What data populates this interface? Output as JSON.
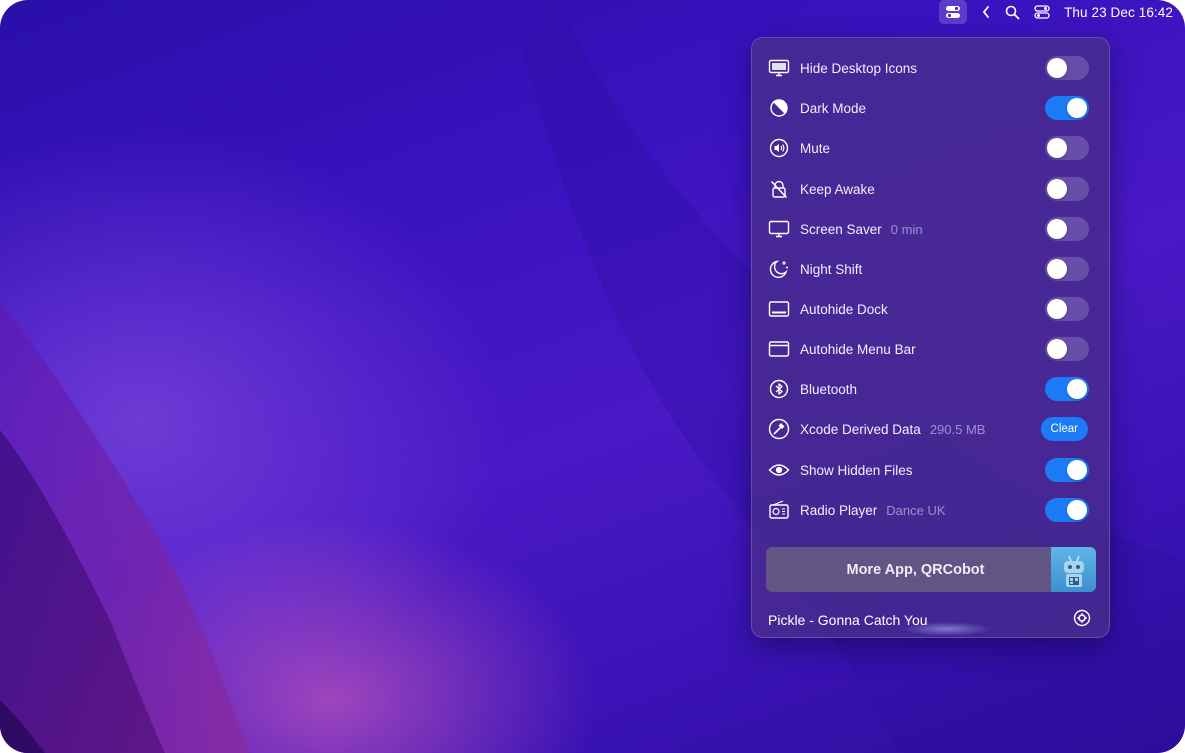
{
  "menubar": {
    "date_time": "Thu 23 Dec  16:42",
    "icons": [
      "app-toggle-icon",
      "chevron-left-icon",
      "search-icon",
      "control-center-icon"
    ]
  },
  "panel": {
    "items": [
      {
        "label": "Hide Desktop Icons",
        "sub": "",
        "icon": "monitor-icon",
        "control": "toggle",
        "on": false
      },
      {
        "label": "Dark Mode",
        "sub": "",
        "icon": "dark-mode-icon",
        "control": "toggle",
        "on": true
      },
      {
        "label": "Mute",
        "sub": "",
        "icon": "speaker-icon",
        "control": "toggle",
        "on": false
      },
      {
        "label": "Keep Awake",
        "sub": "",
        "icon": "lock-slash-icon",
        "control": "toggle",
        "on": false
      },
      {
        "label": "Screen Saver",
        "sub": "0 min",
        "icon": "display-icon",
        "control": "toggle",
        "on": false
      },
      {
        "label": "Night Shift",
        "sub": "",
        "icon": "moon-stars-icon",
        "control": "toggle",
        "on": false
      },
      {
        "label": "Autohide Dock",
        "sub": "",
        "icon": "dock-icon",
        "control": "toggle",
        "on": false
      },
      {
        "label": "Autohide Menu Bar",
        "sub": "",
        "icon": "menu-bar-icon",
        "control": "toggle",
        "on": false
      },
      {
        "label": "Bluetooth",
        "sub": "",
        "icon": "bluetooth-icon",
        "control": "toggle",
        "on": true
      },
      {
        "label": "Xcode Derived Data",
        "sub": "290.5 MB",
        "icon": "hammer-icon",
        "control": "button",
        "button_label": "Clear"
      },
      {
        "label": "Show Hidden Files",
        "sub": "",
        "icon": "eye-icon",
        "control": "toggle",
        "on": true
      },
      {
        "label": "Radio Player",
        "sub": "Dance UK",
        "icon": "radio-icon",
        "control": "toggle",
        "on": true
      }
    ],
    "banner": {
      "text": "More App, QRCobot",
      "image_icon": "robot-icon"
    },
    "footer": {
      "now_playing": "Pickle - Gonna Catch You",
      "settings_icon": "gear-icon"
    }
  },
  "colors": {
    "accent": "#1b7cf5",
    "panel": "#482c8c",
    "desktop": "#3a12bf"
  }
}
